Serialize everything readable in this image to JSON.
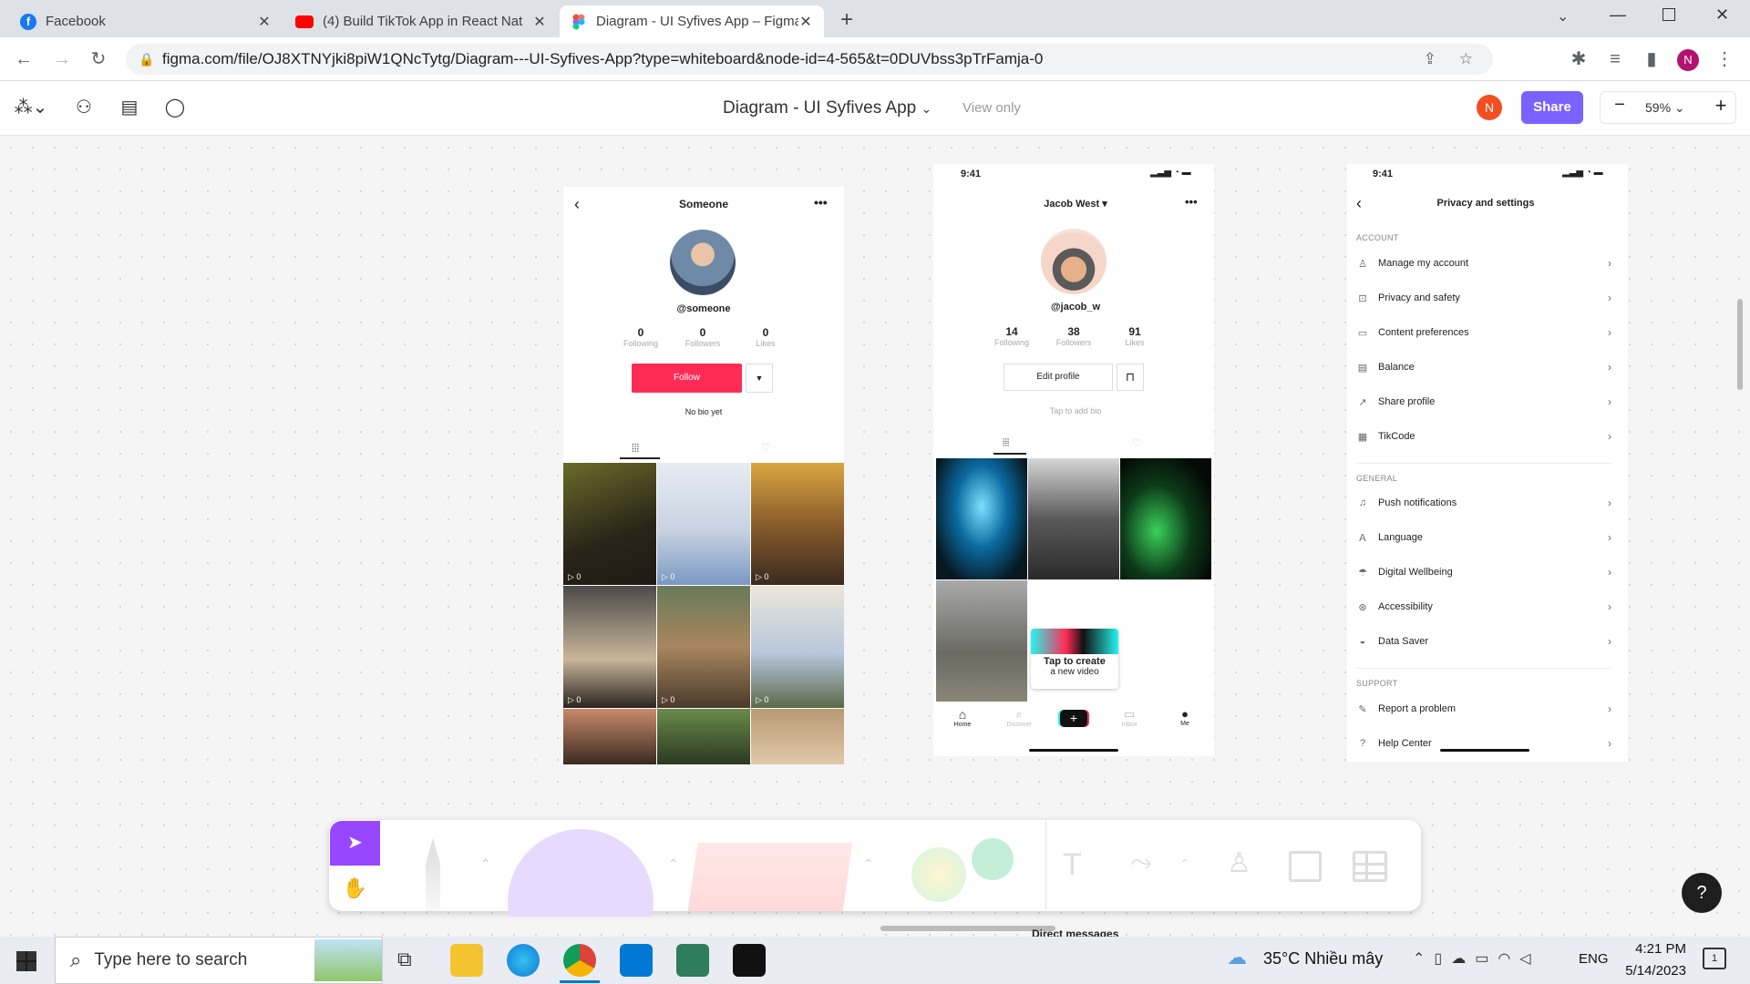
{
  "browser": {
    "tabs": [
      {
        "title": "Facebook",
        "icon": "facebook-icon",
        "active": false
      },
      {
        "title": "(4) Build TikTok App in React Nat",
        "icon": "youtube-icon",
        "active": false
      },
      {
        "title": "Diagram - UI Syfives App – Figma",
        "icon": "figma-icon",
        "active": true
      }
    ],
    "url": "figma.com/file/OJ8XTNYjki8piW1QNcTytg/Diagram---UI-Syfives-App?type=whiteboard&node-id=4-565&t=0DUVbss3pTrFamja-0",
    "profile_initial": "N"
  },
  "figma": {
    "file_title": "Diagram - UI Syfives App",
    "mode": "View only",
    "user_initial": "N",
    "share_label": "Share",
    "zoom": "59%",
    "minus": "−",
    "plus": "+"
  },
  "screen_someone": {
    "title": "Someone",
    "handle": "@someone",
    "stats": [
      {
        "n": "0",
        "l": "Following"
      },
      {
        "n": "0",
        "l": "Followers"
      },
      {
        "n": "0",
        "l": "Likes"
      }
    ],
    "follow_label": "Follow",
    "bio": "No bio yet",
    "video_counts": [
      "0",
      "0",
      "0",
      "0",
      "0",
      "0"
    ]
  },
  "screen_jacob": {
    "time": "9:41",
    "title": "Jacob West",
    "handle": "@jacob_w",
    "stats": [
      {
        "n": "14",
        "l": "Following"
      },
      {
        "n": "38",
        "l": "Followers"
      },
      {
        "n": "91",
        "l": "Likes"
      }
    ],
    "edit_label": "Edit profile",
    "bio_hint": "Tap to add bio",
    "create_line1": "Tap to create",
    "create_line2": "a new video",
    "nav": [
      "Home",
      "Discover",
      "",
      "Inbox",
      "Me"
    ]
  },
  "screen_settings": {
    "time": "9:41",
    "title": "Privacy and settings",
    "account_header": "ACCOUNT",
    "account_items": [
      "Manage my account",
      "Privacy and safety",
      "Content preferences",
      "Balance",
      "Share profile",
      "TikCode"
    ],
    "general_header": "GENERAL",
    "general_items": [
      "Push notifications",
      "Language",
      "Digital Wellbeing",
      "Accessibility",
      "Data Saver"
    ],
    "support_header": "SUPPORT",
    "support_items": [
      "Report a problem",
      "Help Center"
    ]
  },
  "below_canvas": "Direct messages",
  "help_label": "?",
  "taskbar": {
    "search_placeholder": "Type here to search",
    "weather": "35°C  Nhiều mây",
    "lang": "ENG",
    "time": "4:21 PM",
    "date": "5/14/2023",
    "notif": "1"
  }
}
